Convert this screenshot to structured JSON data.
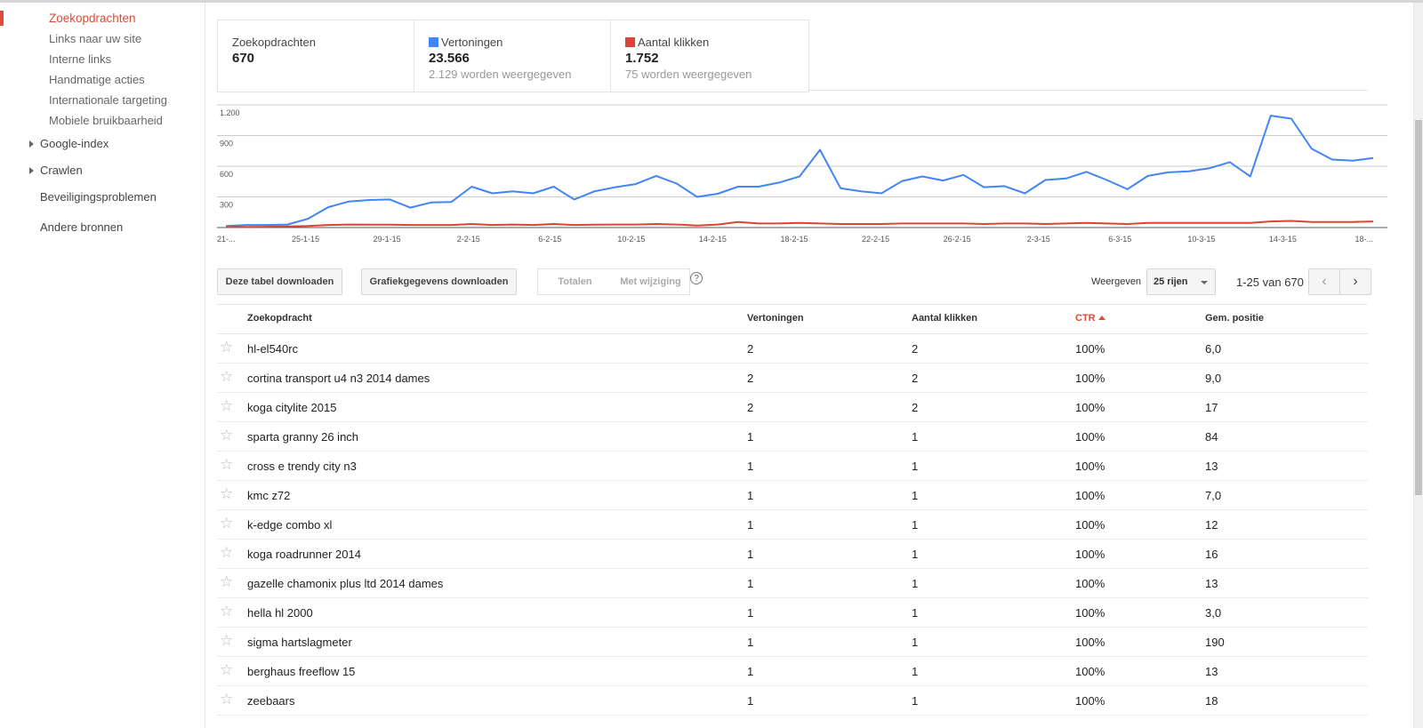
{
  "sidebar": {
    "sub_items": [
      {
        "label": "Zoekopdrachten",
        "active": true
      },
      {
        "label": "Links naar uw site",
        "active": false
      },
      {
        "label": "Interne links",
        "active": false
      },
      {
        "label": "Handmatige acties",
        "active": false
      },
      {
        "label": "Internationale targeting",
        "active": false
      },
      {
        "label": "Mobiele bruikbaarheid",
        "active": false
      }
    ],
    "google_index": "Google-index",
    "crawlen": "Crawlen",
    "beveiligingsproblemen": "Beveiligingsproblemen",
    "andere_bronnen": "Andere bronnen"
  },
  "summary": {
    "queries": {
      "label": "Zoekopdrachten",
      "value": "670"
    },
    "impressions": {
      "label": "Vertoningen",
      "value": "23.566",
      "sub": "2.129 worden weergegeven",
      "color": "#4285f4"
    },
    "clicks": {
      "label": "Aantal klikken",
      "value": "1.752",
      "sub": "75 worden weergegeven",
      "color": "#db4437"
    }
  },
  "chart_data": {
    "type": "line",
    "y_ticks": [
      "1.200",
      "900",
      "600",
      "300"
    ],
    "ylim": [
      0,
      1200
    ],
    "x_tick_labels": [
      "21-...",
      "25-1-15",
      "29-1-15",
      "2-2-15",
      "6-2-15",
      "10-2-15",
      "14-2-15",
      "18-2-15",
      "22-2-15",
      "26-2-15",
      "2-3-15",
      "6-3-15",
      "10-3-15",
      "14-3-15",
      "18-..."
    ],
    "series": [
      {
        "name": "Vertoningen",
        "color": "#4285f4",
        "values": [
          15,
          25,
          25,
          30,
          85,
          200,
          255,
          270,
          275,
          195,
          245,
          250,
          400,
          335,
          355,
          335,
          400,
          275,
          355,
          395,
          425,
          505,
          430,
          300,
          330,
          400,
          400,
          440,
          500,
          760,
          385,
          355,
          335,
          455,
          500,
          460,
          515,
          395,
          405,
          335,
          465,
          480,
          545,
          465,
          375,
          505,
          540,
          550,
          580,
          640,
          500,
          1095,
          1065,
          770,
          665,
          655,
          680
        ]
      },
      {
        "name": "Aantal klikken",
        "color": "#db4437",
        "values": [
          5,
          5,
          8,
          10,
          15,
          25,
          30,
          28,
          28,
          25,
          25,
          25,
          35,
          25,
          30,
          25,
          35,
          25,
          28,
          30,
          30,
          35,
          30,
          20,
          30,
          55,
          40,
          40,
          45,
          40,
          35,
          35,
          35,
          40,
          40,
          40,
          40,
          35,
          40,
          40,
          35,
          40,
          45,
          40,
          35,
          45,
          45,
          45,
          45,
          45,
          45,
          60,
          65,
          55,
          55,
          55,
          60
        ]
      }
    ]
  },
  "toolbar": {
    "download_table": "Deze tabel downloaden",
    "download_chart": "Grafiekgegevens downloaden",
    "totals": "Totalen",
    "with_change": "Met wijziging",
    "help": "?",
    "show_label": "Weergeven",
    "rows_select": "25 rijen",
    "page_count": "1-25 van 670",
    "prev": "‹",
    "next": "›"
  },
  "table": {
    "headers": {
      "query": "Zoekopdracht",
      "impressions": "Vertoningen",
      "clicks": "Aantal klikken",
      "ctr": "CTR",
      "position": "Gem. positie"
    },
    "rows": [
      {
        "query": "hl-el540rc",
        "impressions": "2",
        "clicks": "2",
        "ctr": "100%",
        "position": "6,0"
      },
      {
        "query": "cortina transport u4 n3 2014 dames",
        "impressions": "2",
        "clicks": "2",
        "ctr": "100%",
        "position": "9,0"
      },
      {
        "query": "koga citylite 2015",
        "impressions": "2",
        "clicks": "2",
        "ctr": "100%",
        "position": "17"
      },
      {
        "query": "sparta granny 26 inch",
        "impressions": "1",
        "clicks": "1",
        "ctr": "100%",
        "position": "84"
      },
      {
        "query": "cross e trendy city n3",
        "impressions": "1",
        "clicks": "1",
        "ctr": "100%",
        "position": "13"
      },
      {
        "query": "kmc z72",
        "impressions": "1",
        "clicks": "1",
        "ctr": "100%",
        "position": "7,0"
      },
      {
        "query": "k-edge combo xl",
        "impressions": "1",
        "clicks": "1",
        "ctr": "100%",
        "position": "12"
      },
      {
        "query": "koga roadrunner 2014",
        "impressions": "1",
        "clicks": "1",
        "ctr": "100%",
        "position": "16"
      },
      {
        "query": "gazelle chamonix plus ltd 2014 dames",
        "impressions": "1",
        "clicks": "1",
        "ctr": "100%",
        "position": "13"
      },
      {
        "query": "hella hl 2000",
        "impressions": "1",
        "clicks": "1",
        "ctr": "100%",
        "position": "3,0"
      },
      {
        "query": "sigma hartslagmeter",
        "impressions": "1",
        "clicks": "1",
        "ctr": "100%",
        "position": "190"
      },
      {
        "query": "berghaus freeflow 15",
        "impressions": "1",
        "clicks": "1",
        "ctr": "100%",
        "position": "13"
      },
      {
        "query": "zeebaars",
        "impressions": "1",
        "clicks": "1",
        "ctr": "100%",
        "position": "18"
      }
    ]
  }
}
